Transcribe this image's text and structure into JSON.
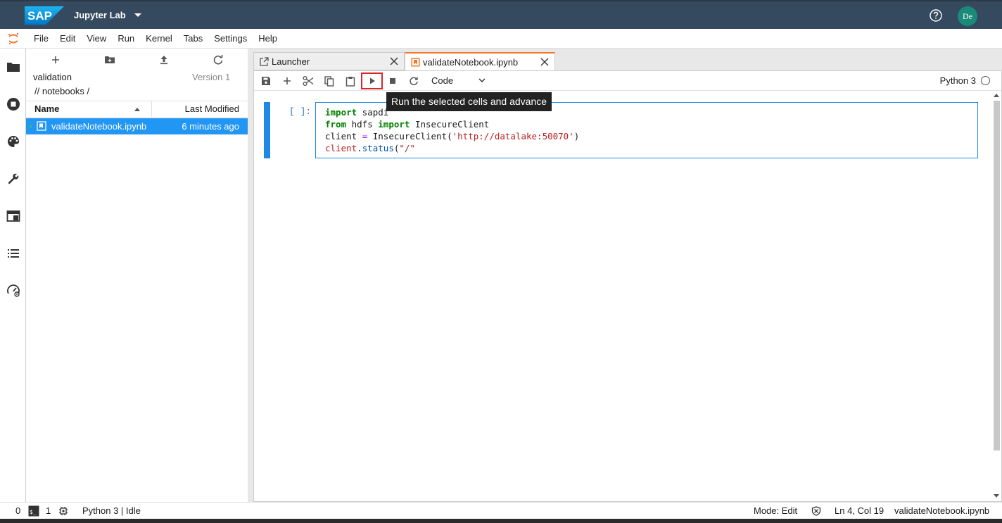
{
  "shell": {
    "logo_text": "SAP",
    "app_title": "Jupyter Lab",
    "avatar_initials": "De",
    "colors": {
      "shell_bg": "#354a5f",
      "avatar_bg": "#1a8a79",
      "accent": "#2196f3",
      "tab_accent": "#f37726"
    }
  },
  "menubar": {
    "items": [
      "File",
      "Edit",
      "View",
      "Run",
      "Kernel",
      "Tabs",
      "Settings",
      "Help"
    ]
  },
  "activitybar": {
    "icons": [
      "folder-icon",
      "running-stop-icon",
      "palette-icon",
      "wrench-icon",
      "tabs-icon",
      "toc-list-icon",
      "dashboard-icon"
    ]
  },
  "filebrowser": {
    "toolbar_icons": [
      "new-launcher-icon",
      "new-folder-icon",
      "upload-icon",
      "refresh-icon"
    ],
    "breadcrumb_top": "validation",
    "version_label": "Version 1",
    "path": "// notebooks /",
    "columns": {
      "name": "Name",
      "modified": "Last Modified"
    },
    "rows": [
      {
        "name": "validateNotebook.ipynb",
        "modified": "6 minutes ago",
        "selected": true
      }
    ]
  },
  "tabs": [
    {
      "label": "Launcher",
      "icon": "launcher-icon",
      "active": false
    },
    {
      "label": "validateNotebook.ipynb",
      "icon": "notebook-icon",
      "active": true
    }
  ],
  "notebook_toolbar": {
    "buttons": [
      "save-icon",
      "add-cell-icon",
      "cut-icon",
      "copy-icon",
      "paste-icon",
      "run-icon",
      "stop-icon",
      "restart-icon"
    ],
    "cell_type": "Code",
    "kernel": "Python 3",
    "tooltip": "Run the selected cells and advance"
  },
  "cell": {
    "prompt": "[ ]:",
    "lines": [
      [
        "import",
        " sapdi"
      ],
      [
        "from",
        " hdfs ",
        "import",
        " InsecureClient"
      ],
      [
        "client ",
        "=",
        " InsecureClient(",
        "'http://datalake:50070'",
        ")"
      ],
      [
        "client",
        ".",
        "status",
        "(",
        "\"/\""
      ]
    ]
  },
  "statusbar": {
    "terminals": "0",
    "kernels": "1",
    "kernel_status": "Python 3 | Idle",
    "mode": "Mode: Edit",
    "position": "Ln 4, Col 19",
    "filename": "validateNotebook.ipynb"
  }
}
